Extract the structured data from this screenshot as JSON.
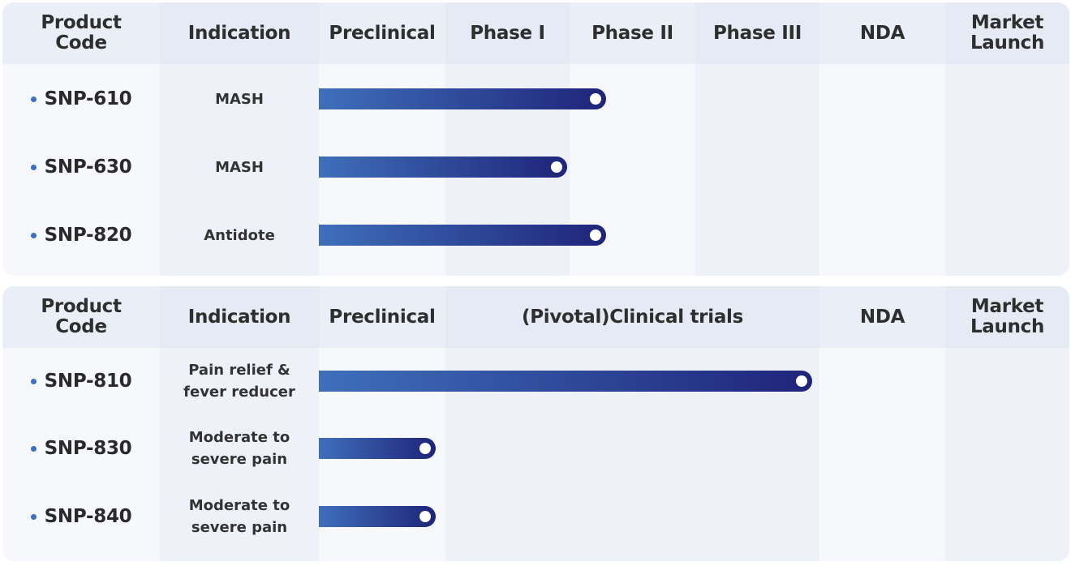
{
  "colors": {
    "bar_start": "#3f6fba",
    "bar_end": "#1f2479",
    "dot": "#3f6fbf"
  },
  "panels": [
    {
      "headers": [
        "Product Code",
        "Indication",
        "Preclinical",
        "Phase I",
        "Phase II",
        "Phase III",
        "NDA",
        "Market Launch"
      ],
      "rows": [
        {
          "code": "SNP-610",
          "indication": "MASH",
          "progress_stages": 2.29
        },
        {
          "code": "SNP-630",
          "indication": "MASH",
          "progress_stages": 1.98
        },
        {
          "code": "SNP-820",
          "indication": "Antidote",
          "progress_stages": 2.29
        }
      ]
    },
    {
      "headers": [
        "Product Code",
        "Indication",
        "Preclinical",
        "(Pivotal)Clinical trials",
        "NDA",
        "Market Launch"
      ],
      "rows": [
        {
          "code": "SNP-810",
          "indication": "Pain relief & fever reducer",
          "progress_stages": 1.98
        },
        {
          "code": "SNP-830",
          "indication": "Moderate to severe pain",
          "progress_stages": 0.92
        },
        {
          "code": "SNP-840",
          "indication": "Moderate to severe pain",
          "progress_stages": 0.92
        }
      ]
    }
  ]
}
